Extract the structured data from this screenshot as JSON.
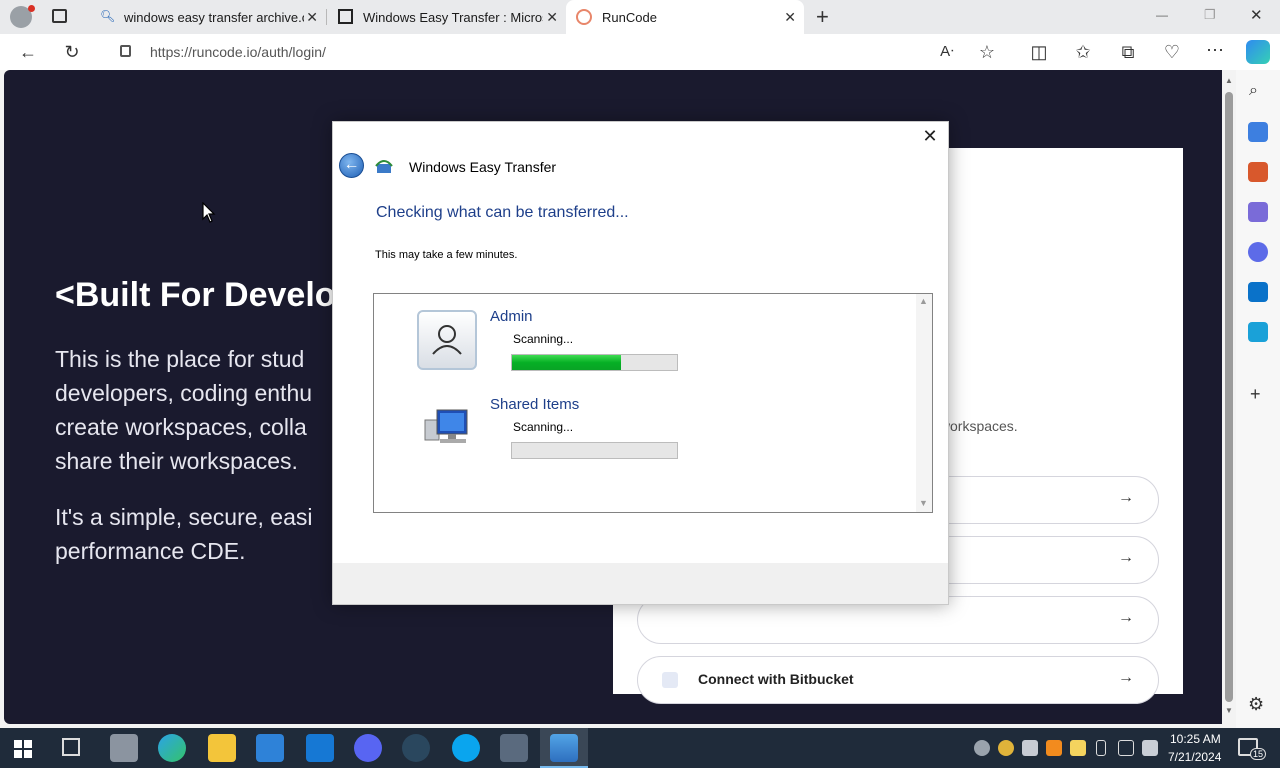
{
  "browser": {
    "tabs": [
      {
        "label": "windows easy transfer archive.or",
        "close": "✕"
      },
      {
        "label": "Windows Easy Transfer : Microso",
        "close": "✕"
      },
      {
        "label": "RunCode",
        "close": "✕"
      }
    ],
    "new_tab": "+",
    "url": "https://runcode.io/auth/login/",
    "window_controls": {
      "minimize": "—",
      "restore": "❐",
      "close": "✕"
    }
  },
  "page": {
    "hero_title": "<Built For Develo",
    "hero_p1": [
      "This is the place for stud",
      "developers, coding enthu",
      "create workspaces, colla",
      "share their workspaces."
    ],
    "hero_p2": [
      "It's a simple, secure, easi",
      "performance CDE."
    ],
    "card_subtitle": "s workspaces.",
    "login_buttons": [
      {
        "label": "",
        "arrow": "→"
      },
      {
        "label": "",
        "arrow": "→"
      },
      {
        "label": "",
        "arrow": "→"
      },
      {
        "label": "Connect with Bitbucket",
        "arrow": "→"
      }
    ]
  },
  "dialog": {
    "title": "Windows Easy Transfer",
    "close": "✕",
    "heading": "Checking what can be transferred...",
    "note": "This may take a few minutes.",
    "items": [
      {
        "name": "Admin",
        "status": "Scanning...",
        "progress": 0.66,
        "icon": "user-account-icon"
      },
      {
        "name": "Shared Items",
        "status": "Scanning...",
        "progress": 0.0,
        "icon": "computer-icon"
      }
    ]
  },
  "taskbar": {
    "time": "10:25 AM",
    "date": "7/21/2024",
    "notification_count": "15"
  },
  "colors": {
    "page_bg": "#1a1a2e",
    "dialog_heading": "#1e3f8a",
    "progress_green": "#06b025",
    "taskbar": "#1f2b3a"
  }
}
